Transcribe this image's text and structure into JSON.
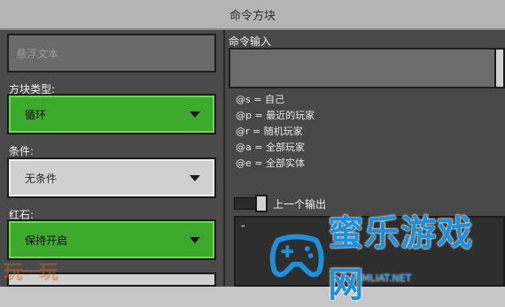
{
  "window": {
    "title": "命令方块"
  },
  "left": {
    "hover_text_placeholder": "悬浮文本",
    "block_type_label": "方块类型:",
    "block_type_value": "循环",
    "condition_label": "条件:",
    "condition_value": "无条件",
    "redstone_label": "红石:",
    "redstone_value": "保持开启"
  },
  "right": {
    "command_input_label": "命令输入",
    "selectors": [
      "@s = 自己",
      "@p = 最近的玩家",
      "@r = 随机玩家",
      "@a = 全部玩家",
      "@e = 全部实体"
    ],
    "previous_output_label": "上一个输出",
    "output_text": "-"
  },
  "colors": {
    "green_dropdown": "#3cab2c",
    "gray_dropdown": "#d0d0d0",
    "panel": "#4a4a4a",
    "watermark": "#1e8fd8"
  },
  "watermark": {
    "brand": "蜜乐游戏网",
    "site": "MLIAT.NET",
    "left_mark": "玩一玩"
  }
}
